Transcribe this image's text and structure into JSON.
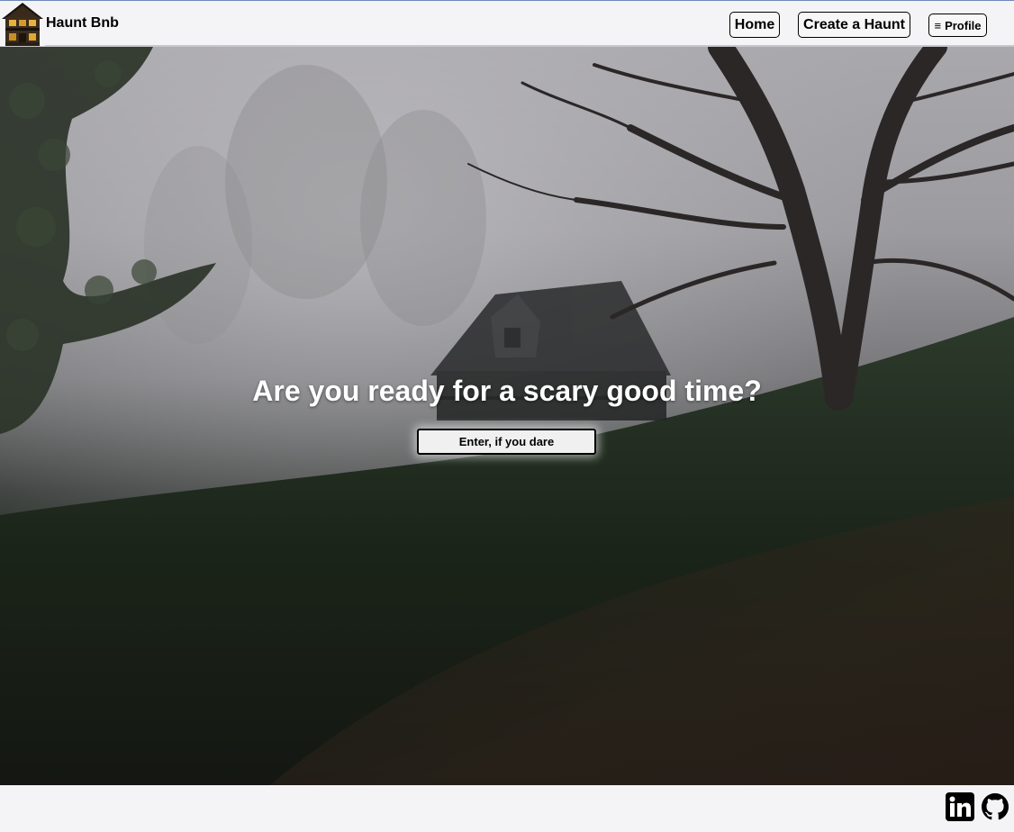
{
  "header": {
    "brand": "Haunt Bnb",
    "nav": {
      "home_label": "Home",
      "create_label": "Create a Haunt",
      "profile_icon": "≡",
      "profile_label": "Profile"
    }
  },
  "hero": {
    "title": "Are you ready for a scary good time?",
    "cta_label": "Enter, if you dare"
  },
  "footer": {
    "icons": [
      "linkedin-icon",
      "github-icon"
    ]
  }
}
